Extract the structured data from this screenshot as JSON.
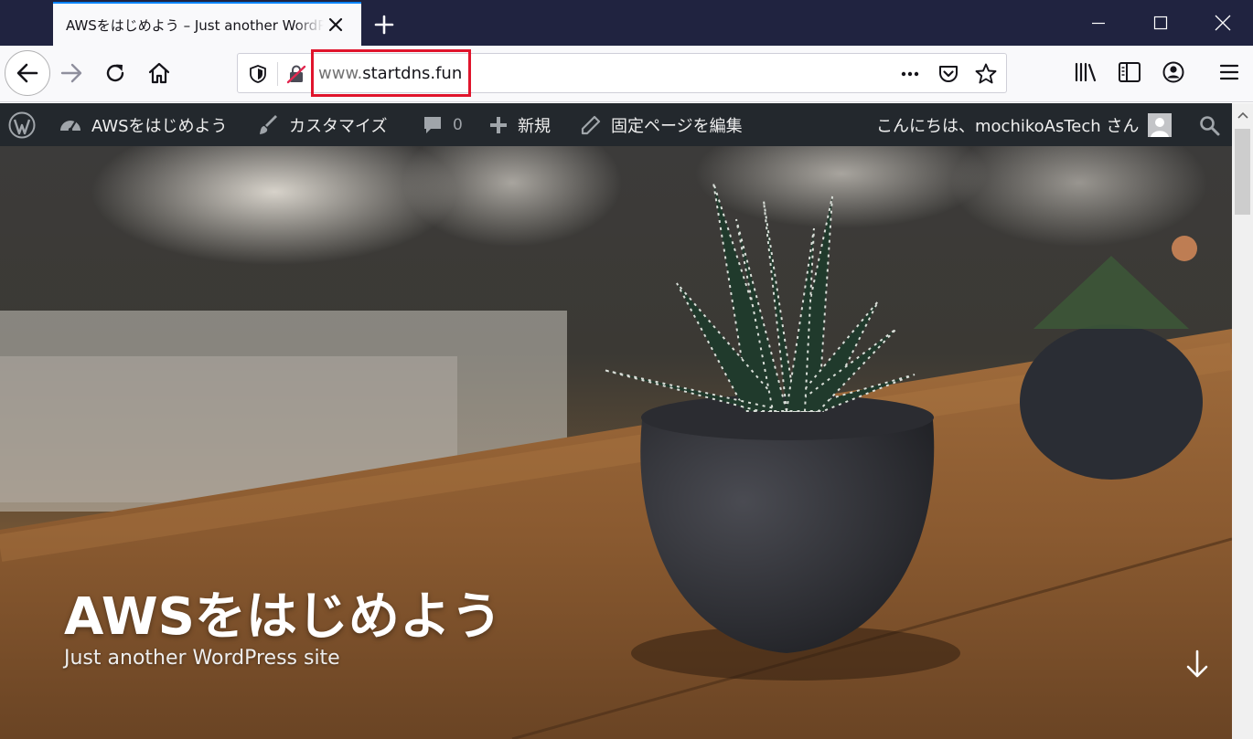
{
  "tab": {
    "title": "AWSをはじめよう – Just another WordPress site",
    "close_icon": "close-icon",
    "new_tab_icon": "plus-icon"
  },
  "window_controls": [
    "minimize-icon",
    "maximize-icon",
    "close-icon"
  ],
  "navbar": {
    "url_prefix": "www.",
    "url_domain": "startdns.fun",
    "buttons": [
      "back-arrow-icon",
      "forward-arrow-icon",
      "reload-icon",
      "home-icon"
    ],
    "url_actions": [
      "page-actions-icon",
      "pocket-icon",
      "star-icon"
    ],
    "toolbar_right": [
      "library-icon",
      "sidebar-icon",
      "account-icon",
      "menu-icon"
    ],
    "highlight_color": "#e0142c"
  },
  "adminbar": {
    "site_name": "AWSをはじめよう",
    "customize": "カスタマイズ",
    "comments_count": "0",
    "new": "新規",
    "edit_page": "固定ページを編集",
    "greeting": "こんにちは、mochikoAsTech さん"
  },
  "hero": {
    "title": "AWSをはじめよう",
    "tagline": "Just another WordPress site"
  }
}
